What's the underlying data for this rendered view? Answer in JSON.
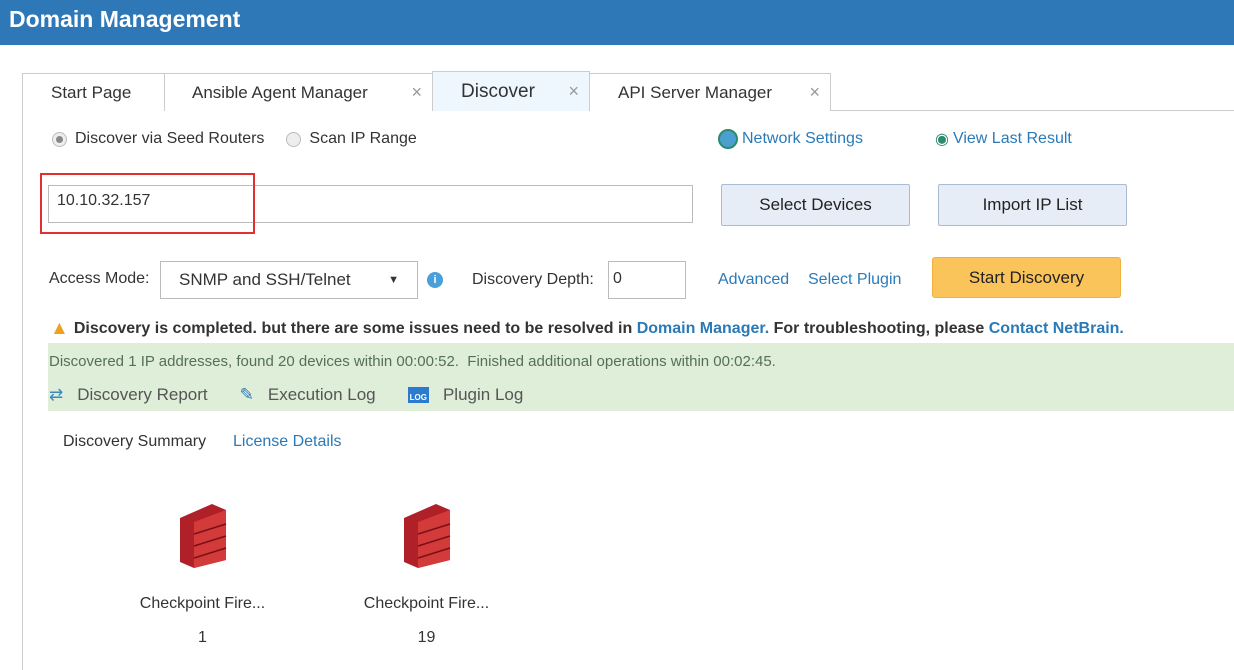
{
  "title": "Domain Management",
  "tabs": [
    {
      "label": "Start Page"
    },
    {
      "label": "Ansible Agent Manager",
      "close": "×"
    },
    {
      "label": "Discover",
      "close": "×"
    },
    {
      "label": "API Server Manager",
      "close": "×"
    }
  ],
  "mode": {
    "seed": "Discover via Seed Routers",
    "scan": "Scan IP Range"
  },
  "links": {
    "network_settings": "Network Settings",
    "view_last": "View Last Result",
    "advanced": "Advanced",
    "select_plugin": "Select Plugin"
  },
  "seed_input": "10.10.32.157",
  "buttons": {
    "select_devices": "Select Devices",
    "import_ip": "Import IP List",
    "start": "Start Discovery"
  },
  "access": {
    "label": "Access Mode:",
    "value": "SNMP and SSH/Telnet",
    "depth_label": "Discovery Depth:",
    "depth": "0"
  },
  "warning": {
    "text": "Discovery is completed. but there are some issues need to be resolved in ",
    "link1": "Domain Manager.",
    "text2": " For troubleshooting, please ",
    "link2": "Contact NetBrain."
  },
  "status": "Discovered 1 IP addresses, found 20 devices within 00:00:52.  Finished additional operations within 00:02:45.",
  "reports": [
    "Discovery Report",
    "Execution Log",
    "Plugin Log"
  ],
  "summary": {
    "label": "Discovery Summary",
    "license": "License Details"
  },
  "devices": [
    {
      "name": "Checkpoint Fire...",
      "count": "1"
    },
    {
      "name": "Checkpoint Fire...",
      "count": "19"
    }
  ]
}
